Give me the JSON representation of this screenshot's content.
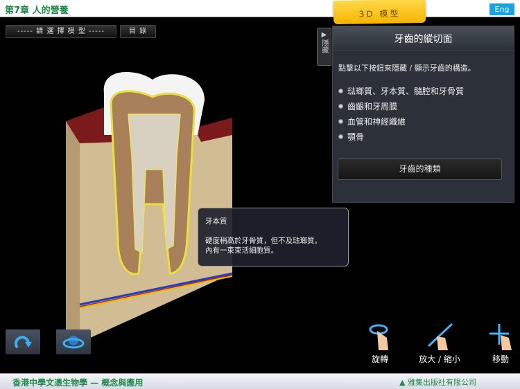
{
  "header": {
    "chapter": "第7章  人的營養",
    "tab_3d": "3D 模型",
    "lang_button": "Eng"
  },
  "toolbar": {
    "model_select": "----- 請 選 擇 模 型 -----",
    "contents": "目 錄"
  },
  "side_tab": {
    "arrow": "▶",
    "label": "隱藏"
  },
  "panel": {
    "title": "牙齒的縱切面",
    "description": "點擊以下按鈕來隱藏 / 顯示牙齒的構造。",
    "options": [
      "琺瑯質、牙本質、髓腔和牙骨質",
      "齒齦和牙周膜",
      "血管和神經纖維",
      "顎骨"
    ],
    "types_button": "牙齒的種類"
  },
  "tooltip": {
    "title": "牙本質",
    "body_line1": "硬度稍高於牙骨質，但不及琺瑯質。",
    "body_line2": "內有一束束活細胞質。"
  },
  "gestures": {
    "rotate": "旋轉",
    "zoom": "放大 / 縮小",
    "move": "移動"
  },
  "footer": {
    "title": "香港中學文憑生物學 — 概念與應用",
    "publisher": "雅集出版社有限公司"
  }
}
